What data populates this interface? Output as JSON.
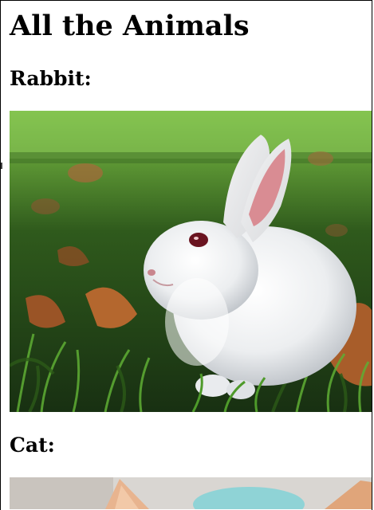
{
  "page": {
    "title": "All the Animals"
  },
  "sections": [
    {
      "heading": "Rabbit:",
      "image_subject": "white rabbit sitting in green grass with fallen leaves"
    },
    {
      "heading": "Cat:",
      "image_subject": "cat with orange ears and teal background (partially visible)"
    }
  ],
  "colors": {
    "background": "#ffffff",
    "text": "#000000",
    "grass_dark": "#1f3a14",
    "grass_light": "#6db33a",
    "rabbit_fur": "#eef0f2",
    "rabbit_ear_inner": "#d98c93",
    "rabbit_eye": "#6a1420",
    "leaf": "#b4672e",
    "cat_ear": "#e8b48f",
    "cat_bg_teal": "#8fd3d6"
  }
}
